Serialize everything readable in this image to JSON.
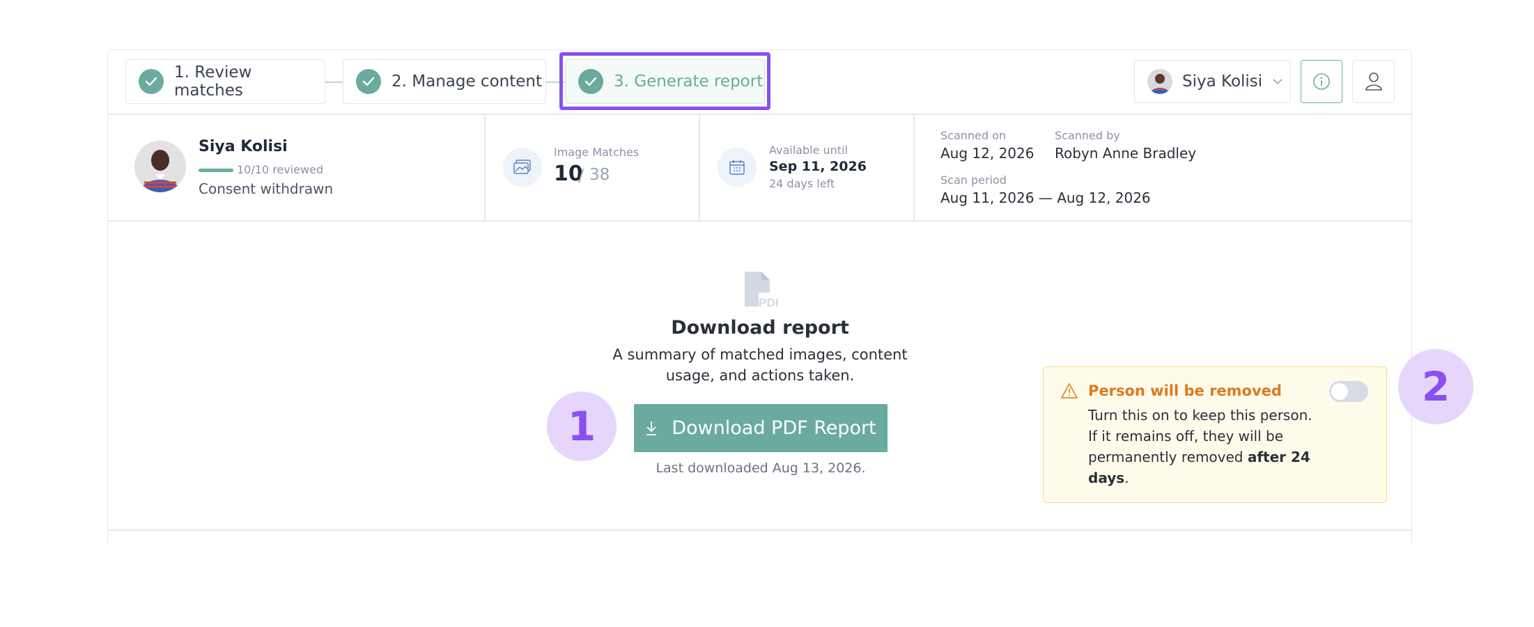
{
  "steps": [
    {
      "label": "1. Review matches",
      "state": "completed"
    },
    {
      "label": "2. Manage content",
      "state": "completed"
    },
    {
      "label": "3. Generate report",
      "state": "active"
    }
  ],
  "person_select": {
    "name": "Siya Kolisi"
  },
  "person": {
    "name": "Siya Kolisi",
    "reviewed": "10/10 reviewed",
    "status": "Consent withdrawn"
  },
  "image_matches": {
    "label": "Image Matches",
    "value": "10",
    "sep": "/",
    "total": "38"
  },
  "availability": {
    "label": "Available until",
    "date": "Sep 11, 2026",
    "remaining": "24 days left"
  },
  "scan": {
    "scanned_on_label": "Scanned on",
    "scanned_on": "Aug 12, 2026",
    "scanned_by_label": "Scanned by",
    "scanned_by": "Robyn Anne Bradley",
    "period_label": "Scan period",
    "period": "Aug 11, 2026 — Aug 12, 2026"
  },
  "report": {
    "icon": "pdf-file-icon",
    "title": "Download report",
    "desc_line1": "A summary of matched images, content",
    "desc_line2": "usage, and actions taken.",
    "button_label": "Download PDF Report",
    "last_downloaded": "Last downloaded Aug 13, 2026."
  },
  "warning": {
    "title": "Person will be removed",
    "body_pre": "Turn this on to keep this person. If it remains off, they will be permanently removed ",
    "body_bold": "after 24 days",
    "body_post": ".",
    "toggle_on": false
  },
  "badges": {
    "one": "1",
    "two": "2"
  },
  "colors": {
    "accent": "#6aaa9f",
    "highlight": "#8b4ff0",
    "warning": "#db7a1d"
  }
}
